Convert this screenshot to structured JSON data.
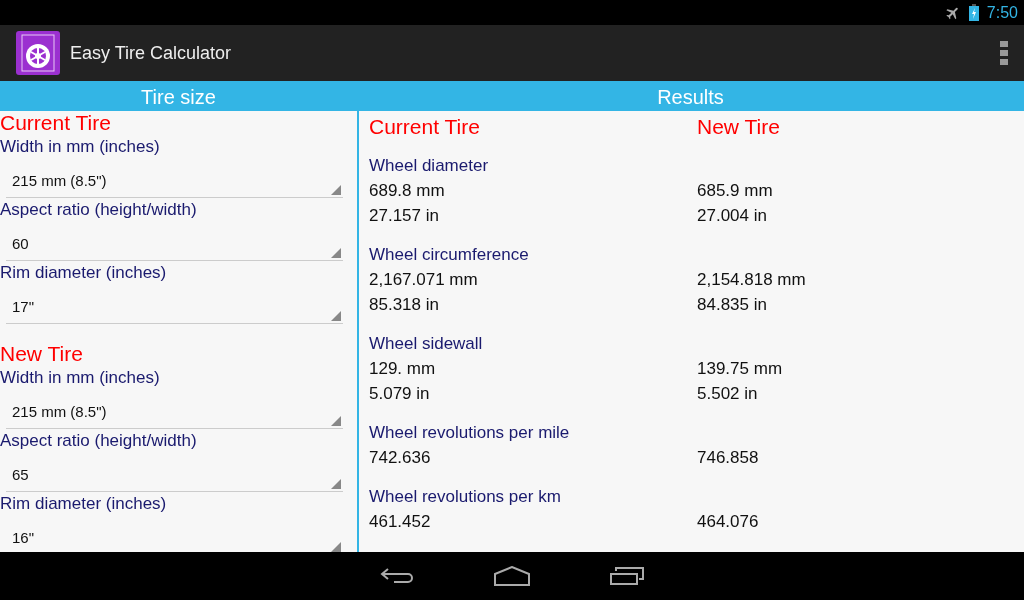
{
  "status_bar": {
    "time": "7:50"
  },
  "app_bar": {
    "title": "Easy Tire Calculator"
  },
  "tire_size": {
    "title": "Tire size",
    "sections": [
      {
        "title": "Current Tire",
        "fields": [
          {
            "label": "Width in mm (inches)",
            "value": "215 mm (8.5\")"
          },
          {
            "label": "Aspect ratio (height/width)",
            "value": "60"
          },
          {
            "label": "Rim diameter (inches)",
            "value": "17\""
          }
        ]
      },
      {
        "title": "New Tire",
        "fields": [
          {
            "label": "Width in mm (inches)",
            "value": "215 mm (8.5\")"
          },
          {
            "label": "Aspect ratio (height/width)",
            "value": "65"
          },
          {
            "label": "Rim diameter (inches)",
            "value": "16\""
          }
        ]
      }
    ]
  },
  "results": {
    "title": "Results",
    "columns": [
      "Current Tire",
      "New Tire"
    ],
    "groups": [
      {
        "label": "Wheel diameter",
        "rows": [
          [
            "689.8 mm",
            "685.9 mm"
          ],
          [
            "27.157 in",
            "27.004 in"
          ]
        ]
      },
      {
        "label": "Wheel circumference",
        "rows": [
          [
            "2,167.071 mm",
            "2,154.818 mm"
          ],
          [
            "85.318 in",
            "84.835 in"
          ]
        ]
      },
      {
        "label": "Wheel sidewall",
        "rows": [
          [
            "129. mm",
            "139.75 mm"
          ],
          [
            "5.079 in",
            "5.502 in"
          ]
        ]
      },
      {
        "label": "Wheel revolutions per mile",
        "rows": [
          [
            "742.636",
            "746.858"
          ]
        ]
      },
      {
        "label": "Wheel revolutions per km",
        "rows": [
          [
            "461.452",
            "464.076"
          ]
        ]
      }
    ]
  }
}
